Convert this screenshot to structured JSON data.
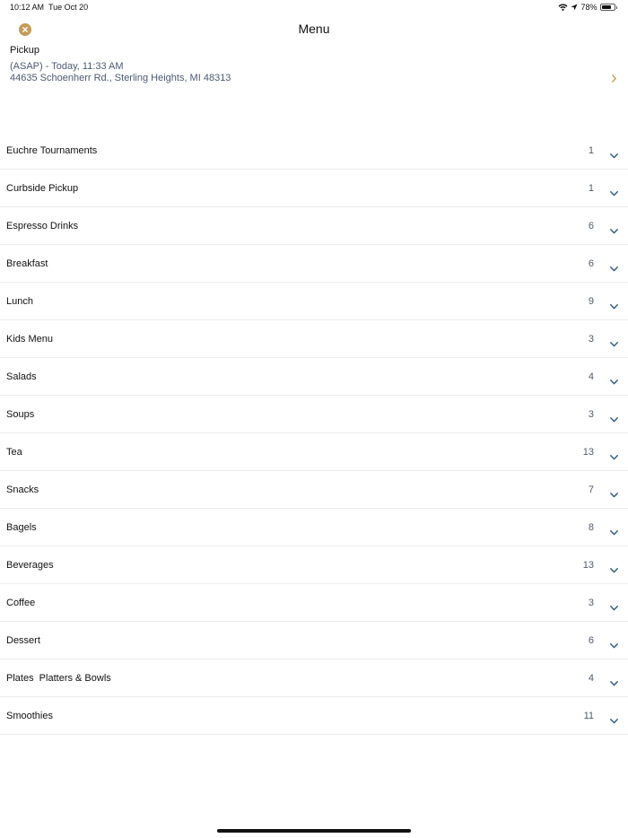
{
  "status_bar": {
    "time": "10:12 AM",
    "date": "Tue Oct 20",
    "battery": "78%",
    "battery_level": 0.78
  },
  "header": {
    "title": "Menu",
    "close_icon": "close-circle-icon"
  },
  "pickup": {
    "label": "Pickup",
    "time": "(ASAP) - Today, 11:33 AM",
    "address": "44635 Schoenherr Rd., Sterling Heights, MI 48313"
  },
  "menu": {
    "items": [
      {
        "label": "Euchre Tournaments",
        "count": "1"
      },
      {
        "label": "Curbside Pickup",
        "count": "1"
      },
      {
        "label": "Espresso Drinks",
        "count": "6"
      },
      {
        "label": "Breakfast",
        "count": "6"
      },
      {
        "label": "Lunch",
        "count": "9"
      },
      {
        "label": "Kids Menu",
        "count": "3"
      },
      {
        "label": "Salads",
        "count": "4"
      },
      {
        "label": "Soups",
        "count": "3"
      },
      {
        "label": "Tea",
        "count": "13"
      },
      {
        "label": "Snacks",
        "count": "7"
      },
      {
        "label": "Bagels",
        "count": "8"
      },
      {
        "label": "Beverages",
        "count": "13"
      },
      {
        "label": "Coffee",
        "count": "3"
      },
      {
        "label": "Dessert",
        "count": "6"
      },
      {
        "label": "Plates  Platters & Bowls",
        "count": "4"
      },
      {
        "label": "Smoothies",
        "count": "11"
      }
    ]
  },
  "colors": {
    "accent": "#c49a5a",
    "secondary_text": "#4c5a70",
    "chevron": "#2d5a80"
  }
}
